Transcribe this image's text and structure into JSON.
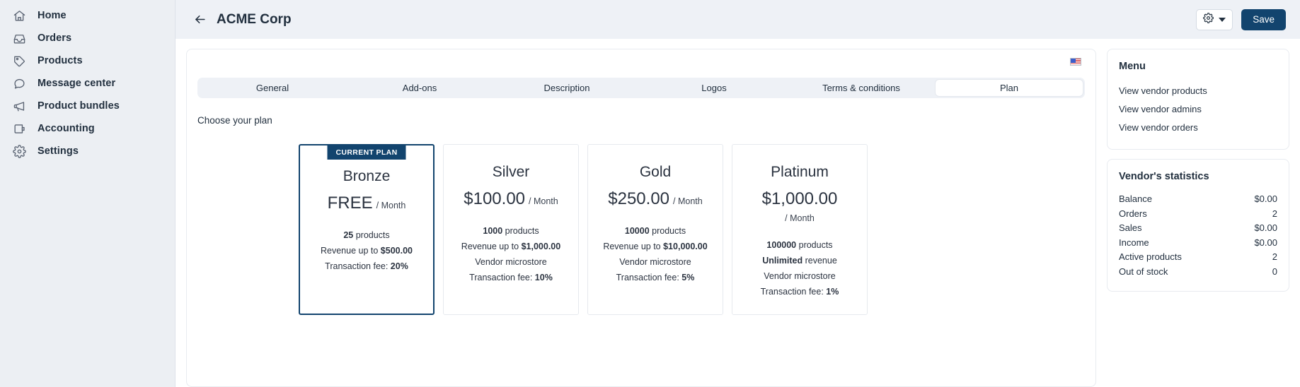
{
  "sidebar": {
    "items": [
      {
        "label": "Home",
        "icon": "home-icon"
      },
      {
        "label": "Orders",
        "icon": "inbox-icon"
      },
      {
        "label": "Products",
        "icon": "tag-icon"
      },
      {
        "label": "Message center",
        "icon": "chat-bubble-icon"
      },
      {
        "label": "Product bundles",
        "icon": "megaphone-icon"
      },
      {
        "label": "Accounting",
        "icon": "wallet-icon"
      },
      {
        "label": "Settings",
        "icon": "gear-icon"
      }
    ]
  },
  "header": {
    "back_icon": "arrow-left-icon",
    "title": "ACME Corp",
    "gear_icon": "gear-icon",
    "gear_caret_icon": "chevron-down-icon",
    "save_label": "Save"
  },
  "panel": {
    "language_flag": "us-flag-icon",
    "tabs": [
      {
        "label": "General",
        "active": false
      },
      {
        "label": "Add-ons",
        "active": false
      },
      {
        "label": "Description",
        "active": false
      },
      {
        "label": "Logos",
        "active": false
      },
      {
        "label": "Terms & conditions",
        "active": false
      },
      {
        "label": "Plan",
        "active": true
      }
    ],
    "choose_label": "Choose your plan",
    "plans": [
      {
        "badge": "CURRENT PLAN",
        "name": "Bronze",
        "price": "FREE",
        "period": "/ Month",
        "period_block": false,
        "current": true,
        "features": [
          {
            "strong": "25",
            "text": " products",
            "lead": ""
          },
          {
            "strong": "$500.00",
            "text": "",
            "lead": "Revenue up to "
          },
          {
            "strong": "20%",
            "text": "",
            "lead": "Transaction fee: "
          }
        ]
      },
      {
        "badge": "",
        "name": "Silver",
        "price": "$100.00",
        "period": "/ Month",
        "period_block": false,
        "current": false,
        "features": [
          {
            "strong": "1000",
            "text": " products",
            "lead": ""
          },
          {
            "strong": "$1,000.00",
            "text": "",
            "lead": "Revenue up to "
          },
          {
            "strong": "",
            "text": "Vendor microstore",
            "lead": ""
          },
          {
            "strong": "10%",
            "text": "",
            "lead": "Transaction fee: "
          }
        ]
      },
      {
        "badge": "",
        "name": "Gold",
        "price": "$250.00",
        "period": "/ Month",
        "period_block": false,
        "current": false,
        "features": [
          {
            "strong": "10000",
            "text": " products",
            "lead": ""
          },
          {
            "strong": "$10,000.00",
            "text": "",
            "lead": "Revenue up to "
          },
          {
            "strong": "",
            "text": "Vendor microstore",
            "lead": ""
          },
          {
            "strong": "5%",
            "text": "",
            "lead": "Transaction fee: "
          }
        ]
      },
      {
        "badge": "",
        "name": "Platinum",
        "price": "$1,000.00",
        "period": "/ Month",
        "period_block": true,
        "current": false,
        "features": [
          {
            "strong": "100000",
            "text": " products",
            "lead": ""
          },
          {
            "strong": "Unlimited",
            "text": " revenue",
            "lead": ""
          },
          {
            "strong": "",
            "text": "Vendor microstore",
            "lead": ""
          },
          {
            "strong": "1%",
            "text": "",
            "lead": "Transaction fee: "
          }
        ]
      }
    ]
  },
  "rail": {
    "menu": {
      "title": "Menu",
      "links": [
        "View vendor products",
        "View vendor admins",
        "View vendor orders"
      ]
    },
    "statistics": {
      "title": "Vendor's statistics",
      "rows": [
        {
          "label": "Balance",
          "value": "$0.00"
        },
        {
          "label": "Orders",
          "value": "2"
        },
        {
          "label": "Sales",
          "value": "$0.00"
        },
        {
          "label": "Income",
          "value": "$0.00"
        },
        {
          "label": "Active products",
          "value": "2"
        },
        {
          "label": "Out of stock",
          "value": "0"
        }
      ]
    }
  },
  "colors": {
    "accent": "#12446e",
    "sidebar_bg": "#eceff3",
    "topbar_bg": "#eef1f6",
    "tabstrip_bg": "#eef1f6",
    "text": "#22303f"
  }
}
